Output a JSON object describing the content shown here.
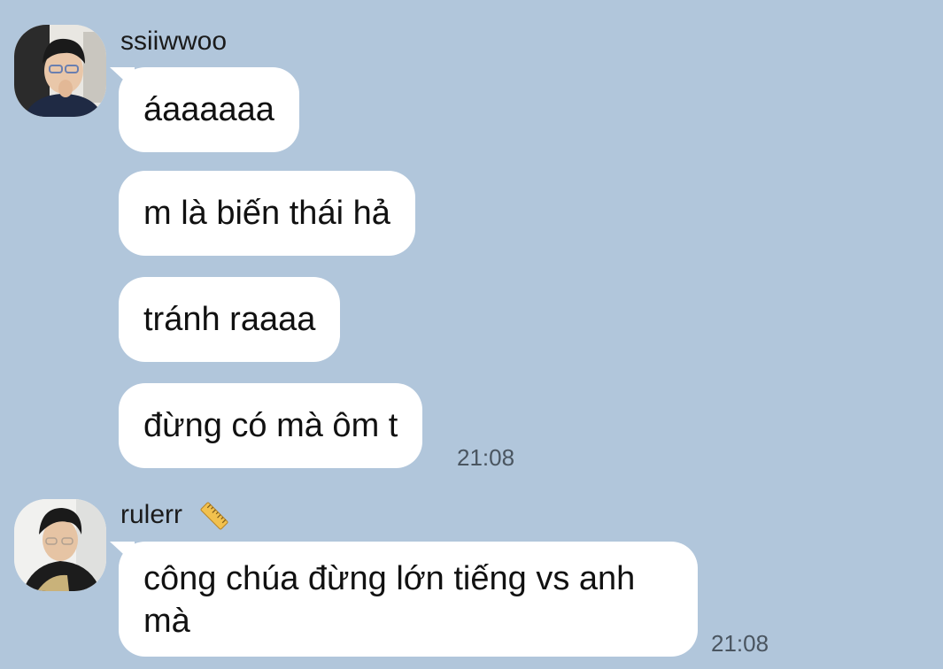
{
  "messages_group_1": {
    "sender": "ssiiwwoo",
    "messages": [
      "áaaaaaa",
      "m là biến thái hả",
      "tránh raaaa",
      "đừng có mà ôm t"
    ],
    "time": "21:08"
  },
  "messages_group_2": {
    "sender": "rulerr",
    "sender_icon": "ruler-icon",
    "messages": [
      "công chúa đừng lớn tiếng vs anh mà"
    ],
    "time": "21:08"
  },
  "colors": {
    "background": "#b1c6db",
    "bubble": "#ffffff",
    "timestamp": "#4a5560"
  }
}
